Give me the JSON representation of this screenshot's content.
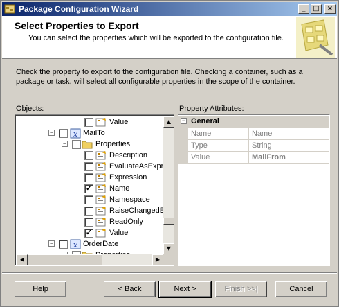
{
  "window": {
    "title": "Package Configuration Wizard"
  },
  "header": {
    "title": "Select Properties to Export",
    "subtitle": "You can select the properties which will be exported to the configuration file.",
    "graphic": "wizard-banner-icon"
  },
  "instructions": "Check the property to export to the configuration file. Checking a container, such as a package or task, will select all configurable properties in the scope of the container.",
  "objects": {
    "label": "Objects:",
    "rows": [
      {
        "text": "Value",
        "checked": false,
        "icon": "property-icon"
      },
      {
        "text": "MailTo",
        "checked": false,
        "icon": "variable-icon",
        "expander": "⊟"
      },
      {
        "text": "Properties",
        "checked": false,
        "icon": "folder-icon",
        "expander": "⊟"
      },
      {
        "text": "Description",
        "checked": false,
        "icon": "property-icon"
      },
      {
        "text": "EvaluateAsExpre",
        "checked": false,
        "icon": "property-icon"
      },
      {
        "text": "Expression",
        "checked": false,
        "icon": "property-icon"
      },
      {
        "text": "Name",
        "checked": true,
        "icon": "property-icon"
      },
      {
        "text": "Namespace",
        "checked": false,
        "icon": "property-icon"
      },
      {
        "text": "RaiseChangedEv",
        "checked": false,
        "icon": "property-icon"
      },
      {
        "text": "ReadOnly",
        "checked": false,
        "icon": "property-icon"
      },
      {
        "text": "Value",
        "checked": true,
        "icon": "property-icon"
      },
      {
        "text": "OrderDate",
        "checked": false,
        "icon": "variable-icon",
        "expander": "⊟"
      },
      {
        "text": "Properties",
        "checked": false,
        "icon": "folder-icon",
        "expander": "⊟"
      }
    ]
  },
  "property_attributes": {
    "label": "Property Attributes:",
    "group": "General",
    "rows": [
      {
        "name": "Name",
        "value": "Name",
        "bold": false
      },
      {
        "name": "Type",
        "value": "String",
        "bold": false
      },
      {
        "name": "Value",
        "value": "MailFrom",
        "bold": true
      }
    ]
  },
  "buttons": {
    "help": "Help",
    "back": "< Back",
    "next": "Next >",
    "finish": "Finish >>|",
    "cancel": "Cancel"
  }
}
